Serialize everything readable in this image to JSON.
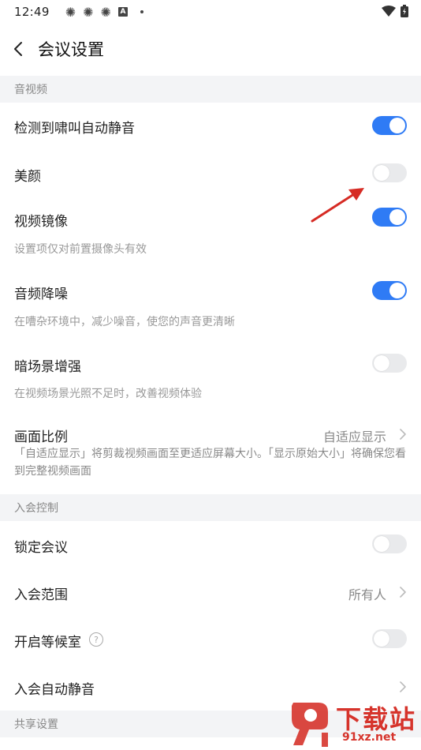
{
  "status_bar": {
    "time": "12:49",
    "badge_letter": "A"
  },
  "header": {
    "title": "会议设置"
  },
  "sections": {
    "av": "音视频",
    "join": "入会控制",
    "share": "共享设置"
  },
  "items": {
    "howl_mute": {
      "label": "检测到啸叫自动静音",
      "enabled": true
    },
    "beauty": {
      "label": "美颜",
      "enabled": false
    },
    "mirror": {
      "label": "视频镜像",
      "desc": "设置项仅对前置摄像头有效",
      "enabled": true
    },
    "noise": {
      "label": "音频降噪",
      "desc": "在嘈杂环境中，减少噪音，使您的声音更清晰",
      "enabled": true
    },
    "dark_scene": {
      "label": "暗场景增强",
      "desc": "在视频场景光照不足时，改善视频体验",
      "enabled": false
    },
    "aspect": {
      "label": "画面比例",
      "value": "自适应显示",
      "desc": "「自适应显示」将剪裁视频画面至更适应屏幕大小。「显示原始大小」将确保您看到完整视频画面"
    },
    "lock": {
      "label": "锁定会议",
      "enabled": false
    },
    "range": {
      "label": "入会范围",
      "value": "所有人"
    },
    "waiting": {
      "label": "开启等候室",
      "help": "?",
      "enabled": false
    },
    "auto_mute": {
      "label": "入会自动静音"
    }
  },
  "watermark": {
    "title": "下载站",
    "url": "91xz.net"
  },
  "colors": {
    "toggle_on": "#2f7bf5",
    "toggle_off": "#e9eaec",
    "annotation_arrow": "#d62b24",
    "watermark": "#d6342c"
  }
}
